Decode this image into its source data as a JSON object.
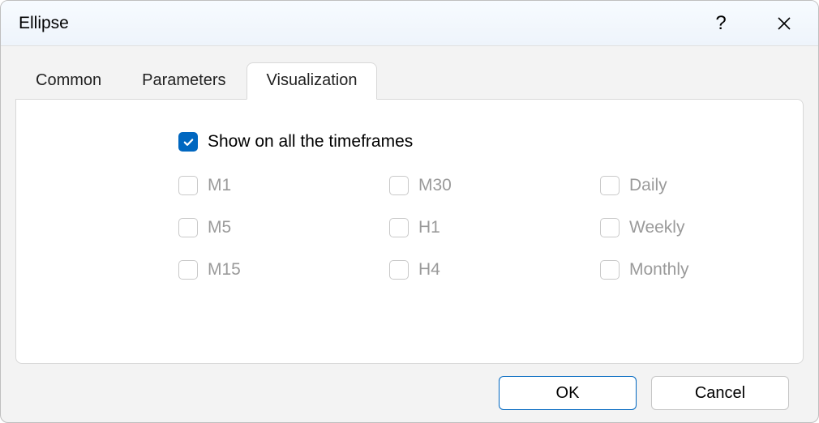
{
  "dialog": {
    "title": "Ellipse"
  },
  "tabs": {
    "items": [
      {
        "label": "Common",
        "active": false
      },
      {
        "label": "Parameters",
        "active": false
      },
      {
        "label": "Visualization",
        "active": true
      }
    ]
  },
  "visualization": {
    "show_all_label": "Show on all the timeframes",
    "show_all_checked": true,
    "timeframes": [
      {
        "label": "M1",
        "checked": false,
        "disabled": true
      },
      {
        "label": "M30",
        "checked": false,
        "disabled": true
      },
      {
        "label": "Daily",
        "checked": false,
        "disabled": true
      },
      {
        "label": "M5",
        "checked": false,
        "disabled": true
      },
      {
        "label": "H1",
        "checked": false,
        "disabled": true
      },
      {
        "label": "Weekly",
        "checked": false,
        "disabled": true
      },
      {
        "label": "M15",
        "checked": false,
        "disabled": true
      },
      {
        "label": "H4",
        "checked": false,
        "disabled": true
      },
      {
        "label": "Monthly",
        "checked": false,
        "disabled": true
      }
    ]
  },
  "footer": {
    "ok_label": "OK",
    "cancel_label": "Cancel"
  }
}
